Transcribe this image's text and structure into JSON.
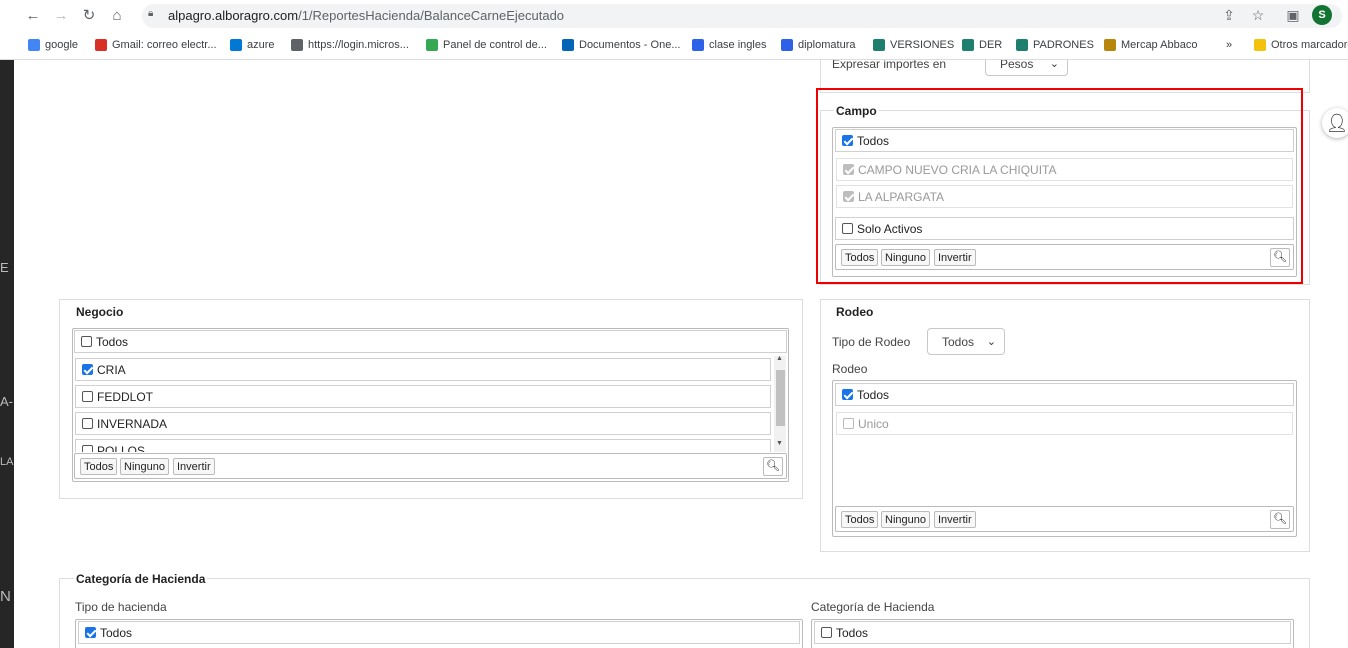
{
  "browser": {
    "url_host": "alpagro.alboragro.com",
    "url_path": "/1/ReportesHacienda/BalanceCarneEjecutado",
    "profile_initial": "S",
    "bookmarks": [
      {
        "label": "google",
        "icon": "google-icon",
        "color": "#4285f4"
      },
      {
        "label": "Gmail: correo electr...",
        "icon": "gmail-icon",
        "color": "#d93025"
      },
      {
        "label": "azure",
        "icon": "azure-icon",
        "color": "#0078d4"
      },
      {
        "label": "https://login.micros...",
        "icon": "globe-icon",
        "color": "#5f6368"
      },
      {
        "label": "Panel de control de...",
        "icon": "panel-icon",
        "color": "#34a853"
      },
      {
        "label": "Documentos - One...",
        "icon": "onedrive-icon",
        "color": "#0364b8"
      },
      {
        "label": "clase ingles",
        "icon": "z-icon",
        "color": "#2d62e8"
      },
      {
        "label": "diplomatura",
        "icon": "z-icon",
        "color": "#2d62e8"
      },
      {
        "label": "VERSIONES",
        "icon": "teams-icon",
        "color": "#1f7f6e"
      },
      {
        "label": "DER",
        "icon": "teams-icon",
        "color": "#1f7f6e"
      },
      {
        "label": "PADRONES",
        "icon": "teams-icon",
        "color": "#1f7f6e"
      },
      {
        "label": "Mercap Abbaco",
        "icon": "mercap-icon",
        "color": "#b8860b"
      }
    ],
    "more": "»",
    "other_bookmarks": "Otros marcadores"
  },
  "top_partial": {
    "label": "Expresar importes en",
    "select_value": "Pesos"
  },
  "campo": {
    "legend": "Campo",
    "all": "Todos",
    "items": [
      "CAMPO NUEVO CRIA LA CHIQUITA",
      "LA ALPARGATA"
    ],
    "solo_activos": "Solo Activos",
    "btn_todos": "Todos",
    "btn_ninguno": "Ninguno",
    "btn_invertir": "Invertir"
  },
  "negocio": {
    "legend": "Negocio",
    "all": "Todos",
    "items": [
      "CRIA",
      "FEDDLOT",
      "INVERNADA",
      "POLLOS"
    ],
    "btn_todos": "Todos",
    "btn_ninguno": "Ninguno",
    "btn_invertir": "Invertir"
  },
  "rodeo": {
    "legend": "Rodeo",
    "tipo_label": "Tipo de Rodeo",
    "tipo_value": "Todos",
    "rodeo_label": "Rodeo",
    "all": "Todos",
    "items": [
      "Unico"
    ],
    "btn_todos": "Todos",
    "btn_ninguno": "Ninguno",
    "btn_invertir": "Invertir"
  },
  "categoria": {
    "legend": "Categoría de Hacienda",
    "tipo_label": "Tipo de hacienda",
    "tipo_all": "Todos",
    "cat_label": "Categoría de Hacienda",
    "cat_all": "Todos"
  },
  "left_fragments": [
    "E",
    "A-",
    "LA",
    "N"
  ],
  "colors": {
    "highlight": "#e00000",
    "checkbox_on": "#1a73e8"
  }
}
